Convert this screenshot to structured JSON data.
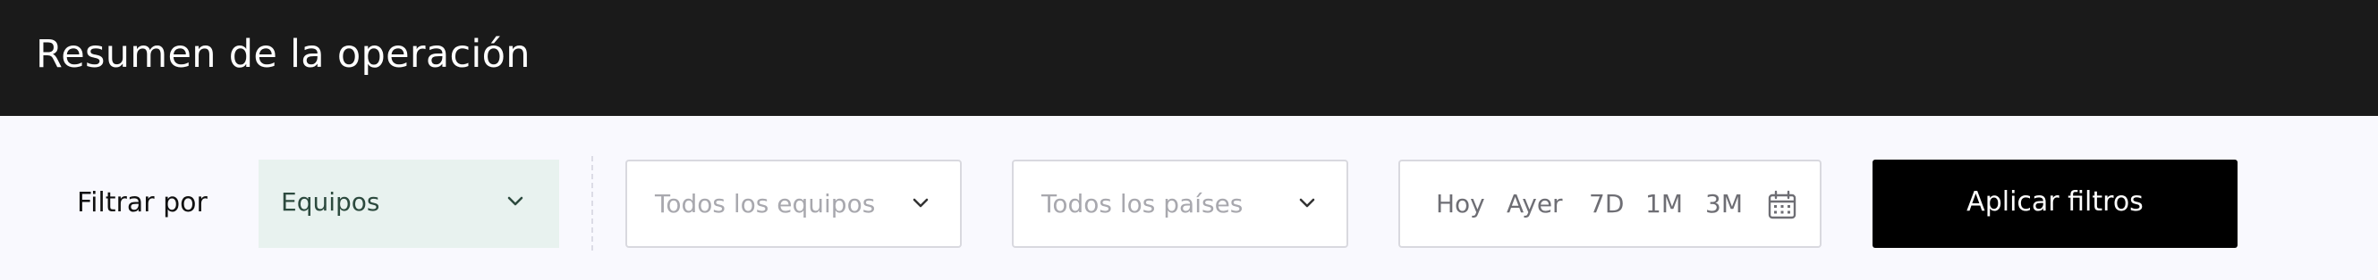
{
  "header": {
    "title": "Resumen de la operación"
  },
  "filters": {
    "label": "Filtrar por",
    "mode_select": {
      "value": "Equipos"
    },
    "teams_select": {
      "placeholder": "Todos los equipos"
    },
    "countries_select": {
      "placeholder": "Todos los países"
    },
    "date_range": {
      "options": [
        "Hoy",
        "Ayer",
        "7D",
        "1M",
        "3M"
      ],
      "icon": "calendar-icon"
    },
    "apply_button": {
      "label": "Aplicar filtros"
    }
  },
  "colors": {
    "header_bg": "#1a1a1a",
    "page_bg": "#f9f9fe",
    "mode_select_bg": "#e8f2ef",
    "mode_select_text": "#2c4a3e",
    "border": "#d9d9df",
    "placeholder_text": "#a8a8ae",
    "date_option_text": "#6e6e74",
    "apply_button_bg": "#000000"
  }
}
